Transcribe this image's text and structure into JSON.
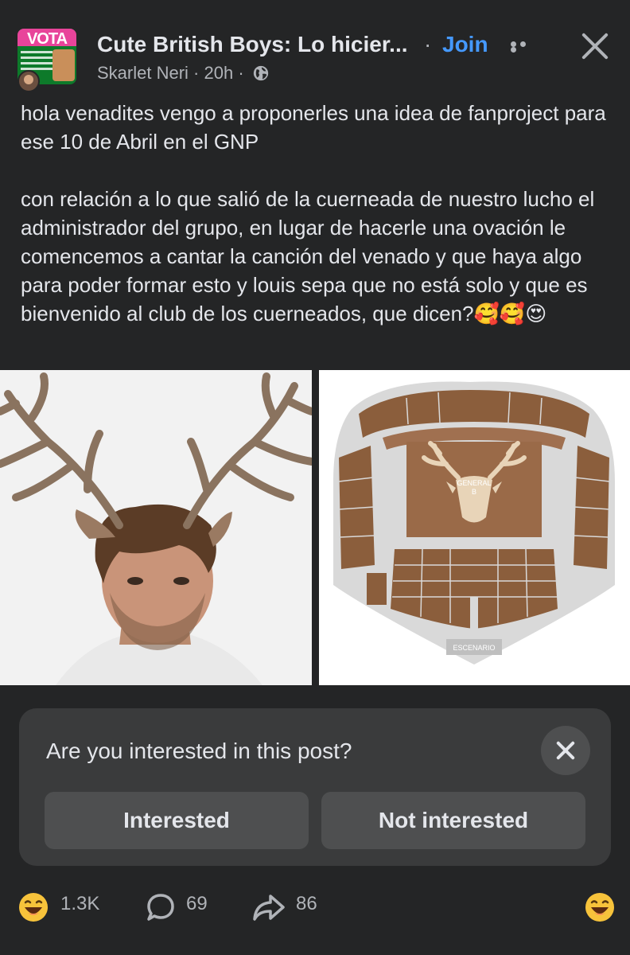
{
  "header": {
    "group_name": "Cute British Boys: Lo hicier...",
    "separator": "·",
    "join_label": "Join",
    "author": "Skarlet Neri",
    "meta_sep": "·",
    "time": "20h",
    "meta_sep2": "·",
    "thumb_word": "VOTA"
  },
  "post": {
    "text": "hola venadites vengo a proponerles una idea de fanproject para ese 10 de Abril en el GNP\n\ncon relación a lo que salió de la cuerneada de nuestro lucho el administrador del grupo, en lugar de hacerle una ovación le comencemos a cantar la canción del venado y que haya algo para poder formar esto y louis sepa que no está solo y que es bienvenido al club de los cuerneados, que dicen?🥰🥰😍"
  },
  "images": {
    "map_center_label_1": "GENERAL",
    "map_center_label_2": "B",
    "map_stage_label": "ESCENARIO"
  },
  "survey": {
    "question": "Are you interested in this post?",
    "interested_label": "Interested",
    "not_interested_label": "Not interested"
  },
  "footer": {
    "reactions_count": "1.3K",
    "comments_count": "69",
    "shares_count": "86"
  },
  "colors": {
    "background": "#242526",
    "accent": "#4599ff",
    "card": "#3a3b3c",
    "button": "#4e4f50",
    "seat_brown": "#8b5e3c"
  }
}
